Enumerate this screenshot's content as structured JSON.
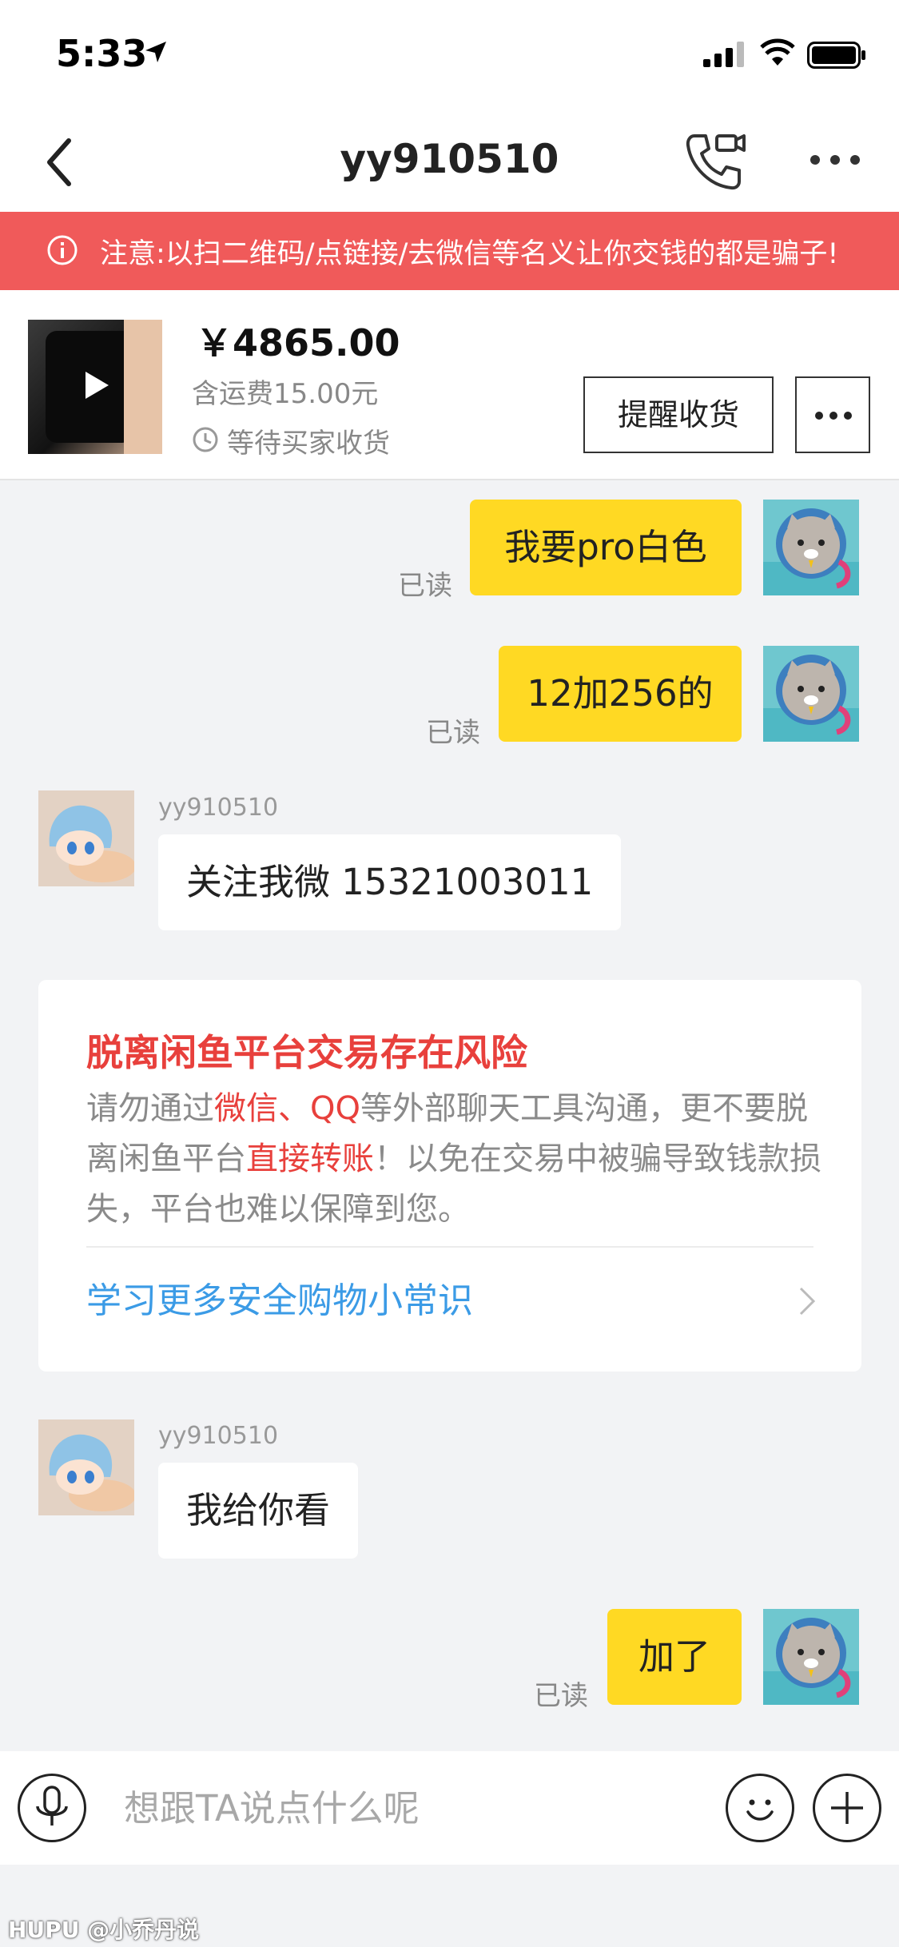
{
  "status_bar": {
    "time": "5:33"
  },
  "nav": {
    "title": "yy910510"
  },
  "warning": {
    "text": "注意:以扫二维码/点链接/去微信等名义让你交钱的都是骗子!"
  },
  "product": {
    "price": "￥4865.00",
    "shipping": "含运费15.00元",
    "status": "等待买家收货",
    "remind_button": "提醒收货"
  },
  "messages": [
    {
      "direction": "outgoing",
      "text": "我要pro白色",
      "read": "已读"
    },
    {
      "direction": "outgoing",
      "text": "12加256的",
      "read": "已读"
    },
    {
      "direction": "incoming",
      "sender": "yy910510",
      "text": "关注我微  15321003011"
    },
    {
      "direction": "incoming",
      "sender": "yy910510",
      "text": "我给你看"
    },
    {
      "direction": "outgoing",
      "text": "加了",
      "read": "已读"
    }
  ],
  "risk_card": {
    "title": "脱离闲鱼平台交易存在风险",
    "body_1": "请勿通过",
    "body_hl_1": "微信、QQ",
    "body_2": "等外部聊天工具沟通，更不要脱离闲鱼平台",
    "body_hl_2": "直接转账",
    "body_3": "！以免在交易中被骗导致钱款损失，平台也难以保障到您。",
    "link": "学习更多安全购物小常识"
  },
  "input": {
    "placeholder": "想跟TA说点什么呢"
  },
  "watermark": "HUPU @小乔丹说",
  "colors": {
    "warning_bg": "#f05a5a",
    "bubble_out": "#ffd923",
    "risk_red": "#e8403c",
    "link_blue": "#3b9be6"
  },
  "icons": [
    "location-arrow-icon",
    "signal-icon",
    "wifi-icon",
    "battery-icon",
    "back-icon",
    "video-call-icon",
    "more-icon",
    "info-icon",
    "play-icon",
    "clock-icon",
    "chevron-right-icon",
    "mic-icon",
    "emoji-icon",
    "plus-icon"
  ]
}
